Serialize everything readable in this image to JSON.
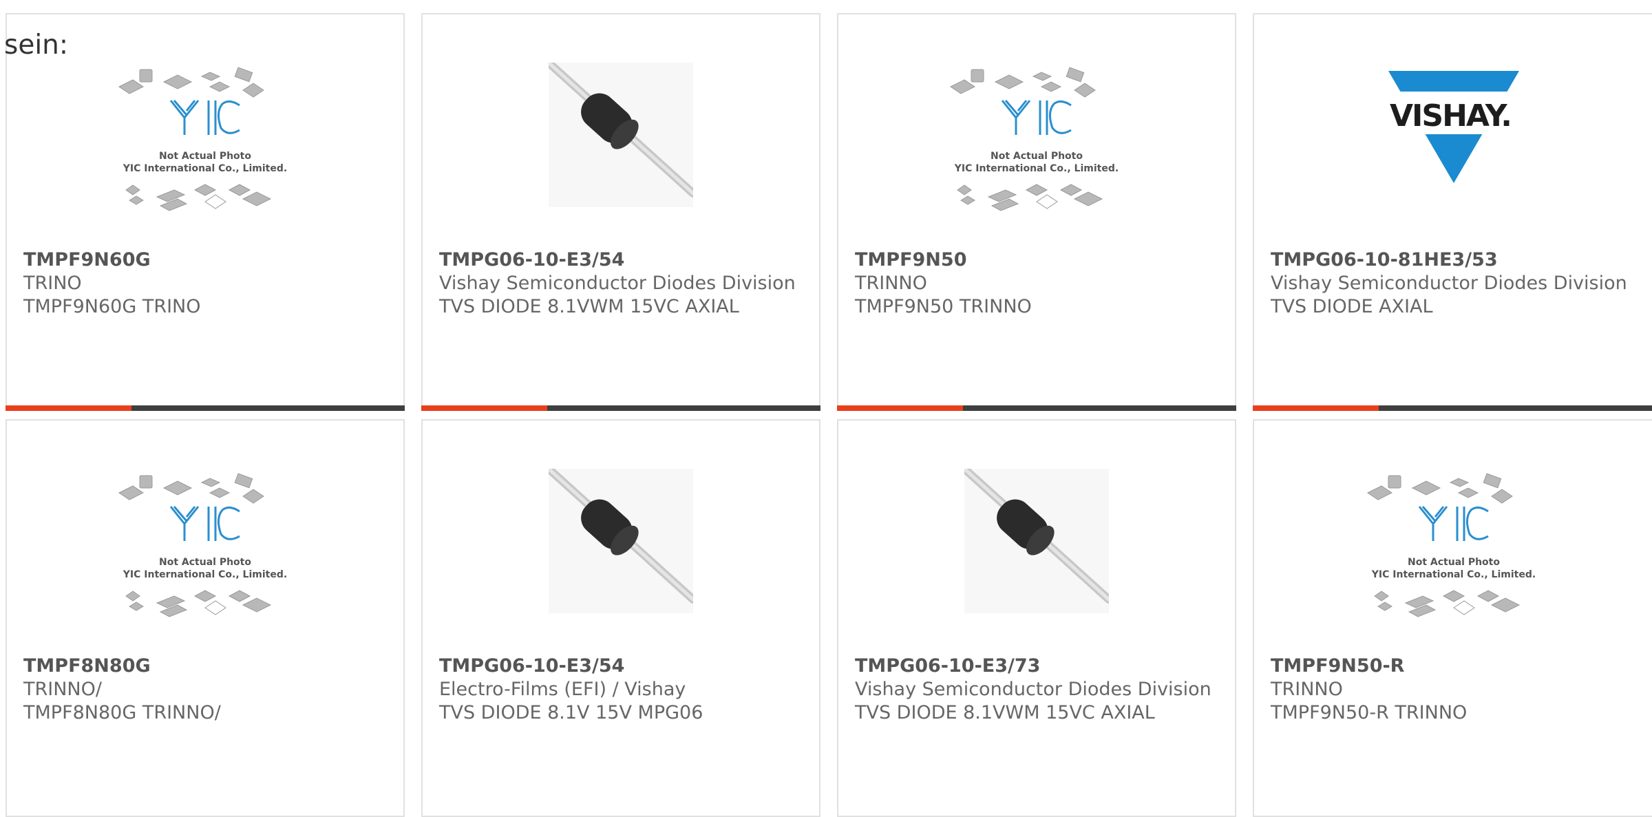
{
  "intro_text": "sein:",
  "colors": {
    "accent": "#e8401c",
    "bar_dark": "#3f3f3f",
    "card_border": "#e1e1e1",
    "vishay_blue": "#1a8bd0",
    "yic_blue": "#2a8fcf"
  },
  "products": [
    {
      "part_number": "TMPF9N60G",
      "manufacturer": "TRINO",
      "description": "TMPF9N60G TRINO",
      "image": "yic-placeholder",
      "image_caption_1": "Not Actual Photo",
      "image_caption_2": "YIC International Co., Limited."
    },
    {
      "part_number": "TMPG06-10-E3/54",
      "manufacturer": "Vishay Semiconductor Diodes Division",
      "description": "TVS DIODE 8.1VWM 15VC AXIAL",
      "image": "axial-diode"
    },
    {
      "part_number": "TMPF9N50",
      "manufacturer": "TRINNO",
      "description": "TMPF9N50 TRINNO",
      "image": "yic-placeholder",
      "image_caption_1": "Not Actual Photo",
      "image_caption_2": "YIC International Co., Limited."
    },
    {
      "part_number": "TMPG06-10-81HE3/53",
      "manufacturer": "Vishay Semiconductor Diodes Division",
      "description": "TVS DIODE AXIAL",
      "image": "vishay-logo",
      "logo_text": "VISHAY."
    },
    {
      "part_number": "TMPF8N80G",
      "manufacturer": "TRINNO/",
      "description": "TMPF8N80G TRINNO/",
      "image": "yic-placeholder",
      "image_caption_1": "Not Actual Photo",
      "image_caption_2": "YIC International Co., Limited."
    },
    {
      "part_number": "TMPG06-10-E3/54",
      "manufacturer": "Electro-Films (EFI) / Vishay",
      "description": "TVS DIODE 8.1V 15V MPG06",
      "image": "axial-diode"
    },
    {
      "part_number": "TMPG06-10-E3/73",
      "manufacturer": "Vishay Semiconductor Diodes Division",
      "description": "TVS DIODE 8.1VWM 15VC AXIAL",
      "image": "axial-diode"
    },
    {
      "part_number": "TMPF9N50-R",
      "manufacturer": "TRINNO",
      "description": "TMPF9N50-R TRINNO",
      "image": "yic-placeholder",
      "image_caption_1": "Not Actual Photo",
      "image_caption_2": "YIC International Co., Limited."
    }
  ]
}
